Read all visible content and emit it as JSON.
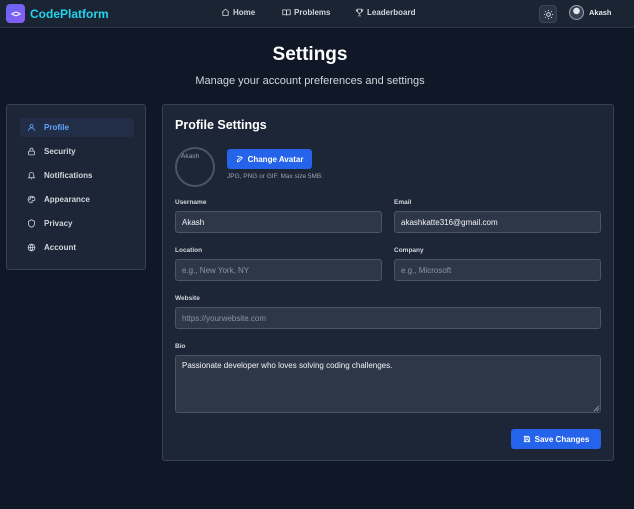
{
  "brand": {
    "name": "CodePlatform",
    "logo_glyph": "<>"
  },
  "nav": {
    "links": [
      {
        "label": "Home",
        "icon": "home-icon"
      },
      {
        "label": "Problems",
        "icon": "book-icon"
      },
      {
        "label": "Leaderboard",
        "icon": "trophy-icon"
      }
    ],
    "theme_icon": "sun-icon",
    "user_name": "Akash"
  },
  "header": {
    "title": "Settings",
    "subtitle": "Manage your account preferences and settings"
  },
  "sidebar": {
    "items": [
      {
        "label": "Profile",
        "icon": "user-icon",
        "active": true
      },
      {
        "label": "Security",
        "icon": "lock-icon",
        "active": false
      },
      {
        "label": "Notifications",
        "icon": "bell-icon",
        "active": false
      },
      {
        "label": "Appearance",
        "icon": "palette-icon",
        "active": false
      },
      {
        "label": "Privacy",
        "icon": "shield-icon",
        "active": false
      },
      {
        "label": "Account",
        "icon": "globe-icon",
        "active": false
      }
    ]
  },
  "profile": {
    "title": "Profile Settings",
    "avatar_alt": "Akash",
    "change_avatar_label": "Change Avatar",
    "avatar_hint": "JPG, PNG or GIF. Max size 5MB.",
    "fields": {
      "username": {
        "label": "Username",
        "value": "Akash",
        "placeholder": ""
      },
      "email": {
        "label": "Email",
        "value": "akashkatte316@gmail.com",
        "placeholder": ""
      },
      "location": {
        "label": "Location",
        "value": "",
        "placeholder": "e.g., New York, NY"
      },
      "company": {
        "label": "Company",
        "value": "",
        "placeholder": "e.g., Microsoft"
      },
      "website": {
        "label": "Website",
        "value": "",
        "placeholder": "https://yourwebsite.com"
      },
      "bio": {
        "label": "Bio",
        "value": "Passionate developer who loves solving coding challenges.",
        "placeholder": ""
      }
    },
    "save_label": "Save Changes"
  },
  "colors": {
    "background": "#101828",
    "panel": "#1d2636",
    "accent": "#2563eb",
    "brand_text": "#22d3ee",
    "active_item": "#60a5fa"
  }
}
